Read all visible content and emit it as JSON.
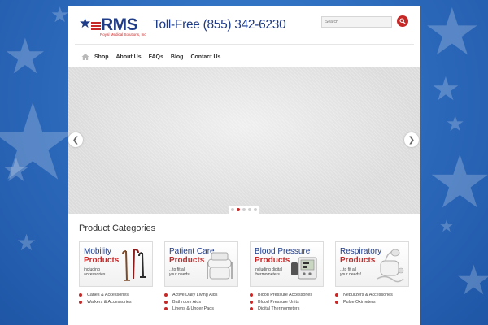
{
  "header": {
    "logo_text": "RMS",
    "logo_sub": "Royal Medical Solutions, Inc",
    "tollfree": "Toll-Free (855) 342-6230",
    "search_placeholder": "Search"
  },
  "nav": {
    "items": [
      {
        "label": "Shop"
      },
      {
        "label": "About Us"
      },
      {
        "label": "FAQs"
      },
      {
        "label": "Blog"
      },
      {
        "label": "Contact Us"
      }
    ]
  },
  "slider": {
    "slide_count": 5,
    "active_slide": 2
  },
  "categories": {
    "title": "Product Categories",
    "cards": [
      {
        "title1": "Mobility",
        "title2": "Products",
        "sub": "including\naccessories...",
        "items": [
          "Canes & Accessories",
          "Walkers & Accessories"
        ]
      },
      {
        "title1": "Patient Care",
        "title2": "Products",
        "sub": "...to fit all\nyour needs!",
        "items": [
          "Active Daily Living Aids",
          "Bathroom Aids",
          "Linens & Under Pads"
        ]
      },
      {
        "title1": "Blood Pressure",
        "title2": "Products",
        "sub": "including digital\nthermometers...",
        "items": [
          "Blood Pressure Accessories",
          "Blood Pressure Units",
          "Digital Thermometers"
        ]
      },
      {
        "title1": "Respiratory",
        "title2": "Products",
        "sub": "...to fit all\nyour needs!",
        "items": [
          "Nebulizers & Accessories",
          "Pulse Oximeters"
        ]
      }
    ]
  },
  "colors": {
    "brand_blue": "#1f3c88",
    "brand_red": "#c62828",
    "background": "#2f6fbf"
  }
}
